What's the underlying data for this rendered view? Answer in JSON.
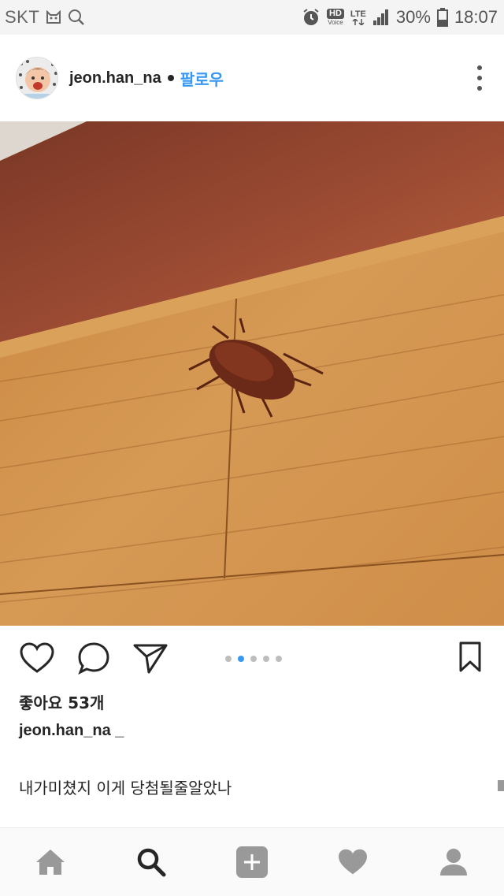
{
  "status_bar": {
    "carrier": "SKT",
    "hd_label": "HD",
    "voice_label": "Voice",
    "network": "LTE",
    "battery": "30%",
    "time": "18:07"
  },
  "post": {
    "username": "jeon.han_na",
    "follow_label": "팔로우",
    "likes": "좋아요 53개",
    "caption_username": "jeon.han_na _",
    "caption_text": "내가미쳤지 이게 당첨될줄알았나",
    "carousel": {
      "count": 5,
      "active_index": 1
    }
  },
  "colors": {
    "accent": "#3897f0",
    "text": "#262626",
    "icon_gray": "#999999"
  },
  "icons": {
    "like": "heart-icon",
    "comment": "comment-icon",
    "share": "share-icon",
    "save": "bookmark-icon",
    "more": "more-vertical-icon",
    "nav": [
      "home-icon",
      "search-icon",
      "add-icon",
      "activity-heart-icon",
      "profile-icon"
    ]
  }
}
